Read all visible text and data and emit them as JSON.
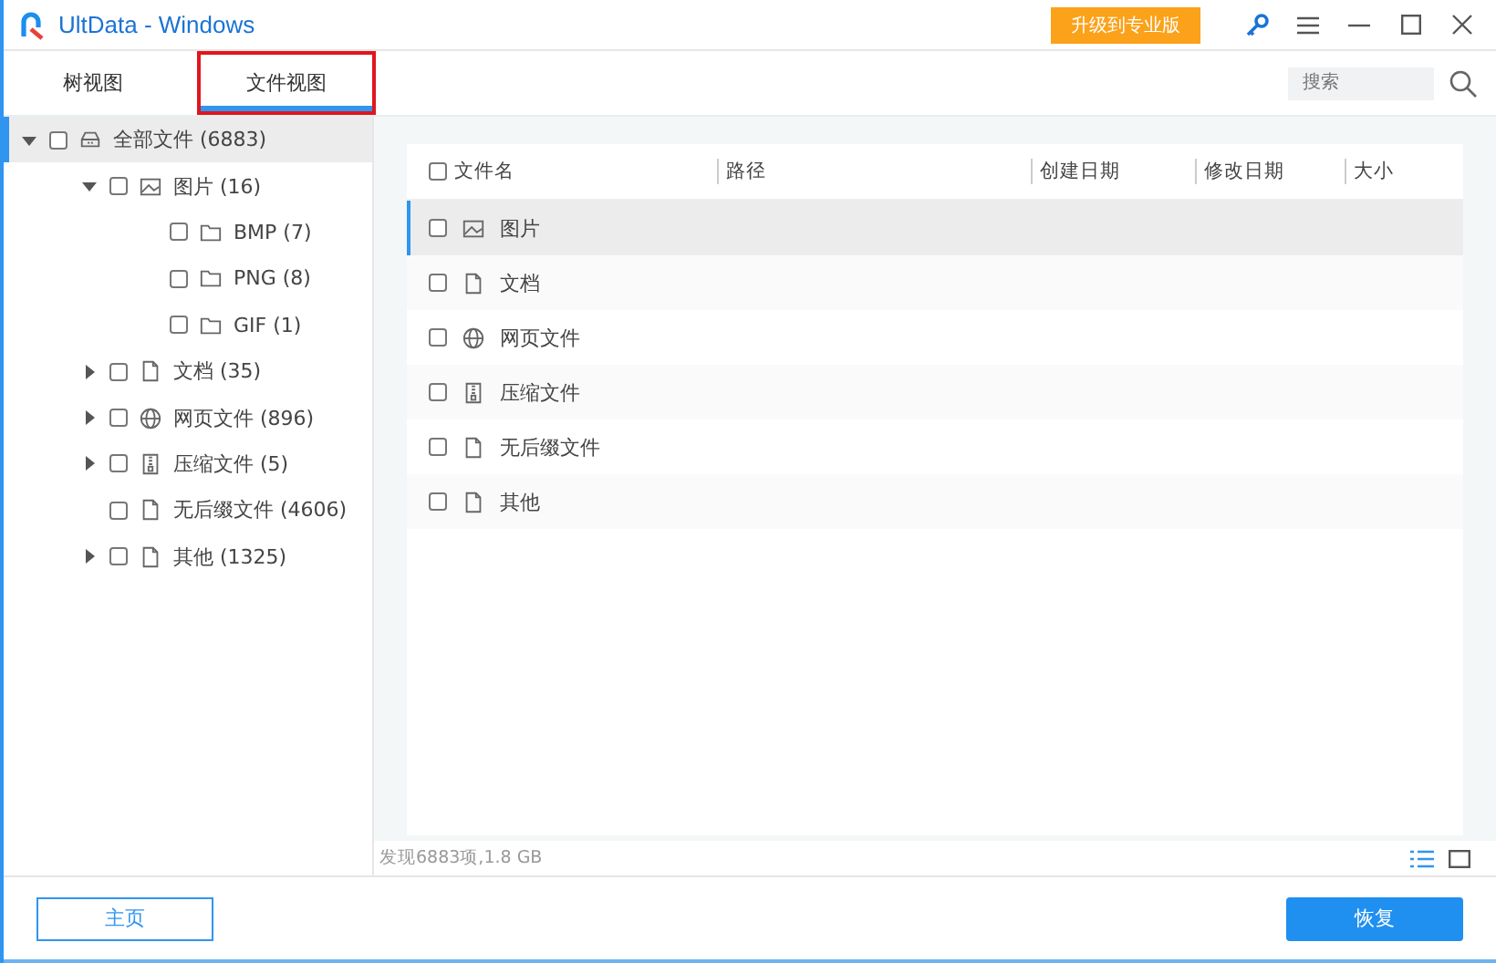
{
  "window": {
    "title": "UltData - Windows",
    "upgrade_button": "升级到专业版"
  },
  "tabs": [
    {
      "label": "树视图",
      "selected": false,
      "highlighted": false
    },
    {
      "label": "文件视图",
      "selected": true,
      "highlighted": true
    }
  ],
  "search": {
    "placeholder": "搜索"
  },
  "tree": [
    {
      "label": "全部文件 (6883)",
      "kind": "drive",
      "checked": false,
      "selected": true,
      "expanded": true,
      "children": [
        {
          "label": "图片 (16)",
          "kind": "image",
          "checked": false,
          "selected": false,
          "expanded": true,
          "children": [
            {
              "label": "BMP (7)",
              "kind": "folder",
              "checked": false,
              "selected": false
            },
            {
              "label": "PNG (8)",
              "kind": "folder",
              "checked": false,
              "selected": false
            },
            {
              "label": "GIF (1)",
              "kind": "folder",
              "checked": false,
              "selected": false
            }
          ]
        },
        {
          "label": "文档 (35)",
          "kind": "document",
          "checked": false,
          "selected": false,
          "expanded": false
        },
        {
          "label": "网页文件 (896)",
          "kind": "globe",
          "checked": false,
          "selected": false,
          "expanded": false
        },
        {
          "label": "压缩文件 (5)",
          "kind": "archive",
          "checked": false,
          "selected": false,
          "expanded": false
        },
        {
          "label": "无后缀文件 (4606)",
          "kind": "document",
          "checked": false,
          "selected": false
        },
        {
          "label": "其他 (1325)",
          "kind": "document",
          "checked": false,
          "selected": false,
          "expanded": false
        }
      ]
    }
  ],
  "table": {
    "select_all_checked": false,
    "columns": [
      "文件名",
      "路径",
      "创建日期",
      "修改日期",
      "大小"
    ],
    "rows": [
      {
        "name": "图片",
        "kind": "image",
        "checked": false,
        "selected": true
      },
      {
        "name": "文档",
        "kind": "document",
        "checked": false,
        "selected": false
      },
      {
        "name": "网页文件",
        "kind": "globe",
        "checked": false,
        "selected": false
      },
      {
        "name": "压缩文件",
        "kind": "archive",
        "checked": false,
        "selected": false
      },
      {
        "name": "无后缀文件",
        "kind": "document",
        "checked": false,
        "selected": false
      },
      {
        "name": "其他",
        "kind": "document",
        "checked": false,
        "selected": false
      }
    ]
  },
  "status_bar": {
    "text": "发现6883项,1.8 GB"
  },
  "buttons": {
    "home": "主页",
    "recover": "恢复"
  }
}
